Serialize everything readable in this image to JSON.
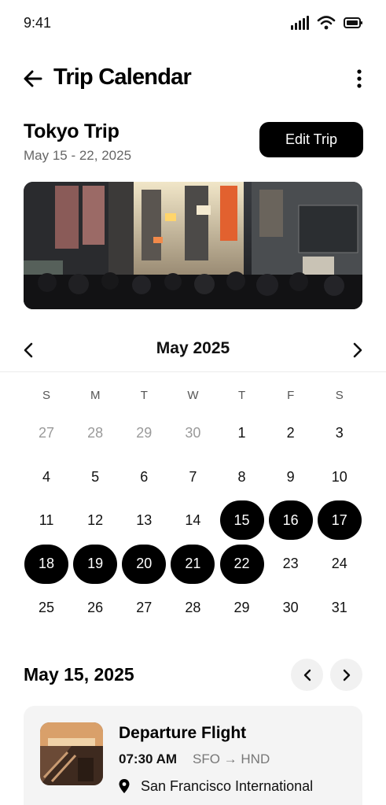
{
  "status_bar": {
    "time": "9:41",
    "icons": [
      "signal-icon",
      "wifi-icon",
      "battery-icon"
    ]
  },
  "header": {
    "title": "Trip Calendar",
    "back_icon": "arrow-left-icon",
    "more_icon": "more-vertical-icon"
  },
  "trip": {
    "name": "Tokyo Trip",
    "dates": "May 15 - 22, 2025",
    "edit_label": "Edit Trip"
  },
  "calendar": {
    "month_label": "May 2025",
    "weekdays": [
      "S",
      "M",
      "T",
      "W",
      "T",
      "F",
      "S"
    ],
    "days": [
      {
        "label": "27",
        "muted": true,
        "selected": false
      },
      {
        "label": "28",
        "muted": true,
        "selected": false
      },
      {
        "label": "29",
        "muted": true,
        "selected": false
      },
      {
        "label": "30",
        "muted": true,
        "selected": false
      },
      {
        "label": "1",
        "muted": false,
        "selected": false
      },
      {
        "label": "2",
        "muted": false,
        "selected": false
      },
      {
        "label": "3",
        "muted": false,
        "selected": false
      },
      {
        "label": "4",
        "muted": false,
        "selected": false
      },
      {
        "label": "5",
        "muted": false,
        "selected": false
      },
      {
        "label": "6",
        "muted": false,
        "selected": false
      },
      {
        "label": "7",
        "muted": false,
        "selected": false
      },
      {
        "label": "8",
        "muted": false,
        "selected": false
      },
      {
        "label": "9",
        "muted": false,
        "selected": false
      },
      {
        "label": "10",
        "muted": false,
        "selected": false
      },
      {
        "label": "11",
        "muted": false,
        "selected": false
      },
      {
        "label": "12",
        "muted": false,
        "selected": false
      },
      {
        "label": "13",
        "muted": false,
        "selected": false
      },
      {
        "label": "14",
        "muted": false,
        "selected": false
      },
      {
        "label": "15",
        "muted": false,
        "selected": true
      },
      {
        "label": "16",
        "muted": false,
        "selected": true
      },
      {
        "label": "17",
        "muted": false,
        "selected": true
      },
      {
        "label": "18",
        "muted": false,
        "selected": true
      },
      {
        "label": "19",
        "muted": false,
        "selected": true
      },
      {
        "label": "20",
        "muted": false,
        "selected": true
      },
      {
        "label": "21",
        "muted": false,
        "selected": true
      },
      {
        "label": "22",
        "muted": false,
        "selected": true
      },
      {
        "label": "23",
        "muted": false,
        "selected": false
      },
      {
        "label": "24",
        "muted": false,
        "selected": false
      },
      {
        "label": "25",
        "muted": false,
        "selected": false
      },
      {
        "label": "26",
        "muted": false,
        "selected": false
      },
      {
        "label": "27",
        "muted": false,
        "selected": false
      },
      {
        "label": "28",
        "muted": false,
        "selected": false
      },
      {
        "label": "29",
        "muted": false,
        "selected": false
      },
      {
        "label": "30",
        "muted": false,
        "selected": false
      },
      {
        "label": "31",
        "muted": false,
        "selected": false
      }
    ]
  },
  "schedule": {
    "date_label": "May 15, 2025",
    "event": {
      "title": "Departure Flight",
      "time": "07:30 AM",
      "route": "SFO → HND",
      "location": "San Francisco International"
    }
  },
  "colors": {
    "accent": "#000000",
    "card_bg": "#f4f4f4",
    "muted_text": "#9a9a9a"
  }
}
